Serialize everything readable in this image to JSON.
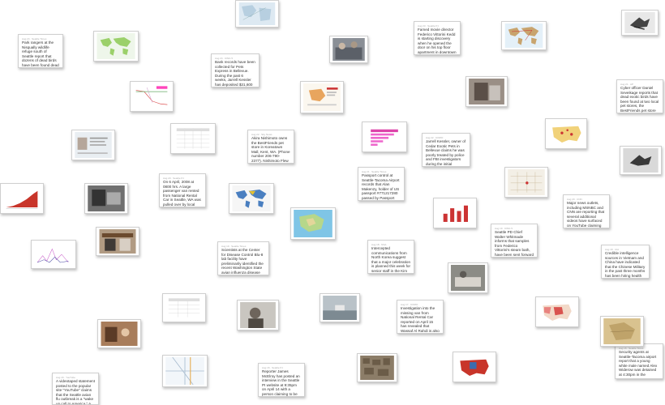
{
  "colors": {
    "map_green": "#9bd06a",
    "map_sea": "#cfe6f5",
    "heat_red": "#c8352a",
    "photo_gray": "#7a7a7a"
  },
  "notes": [
    {
      "meta": "Aug 24 · Seattle Times",
      "text": "Park rangers at the Nisqually wildlife refuge south of Seattle report that dozens of dead birds have been found dead in the past 24 hours in and"
    },
    {
      "meta": "Aug 24 · KING 5",
      "text": "Bank records have been collected for Pets Express in Bellevue. During the past 6 weeks, Jarrell Kessler has deposited $31,600 in"
    },
    {
      "meta": "Aug 23 · Seattle P-I",
      "text": "Famed movie director Federico Vittorini Kedd is starting discovery when he opened the door on his top floor apartment in downtown"
    },
    {
      "meta": "Aug 22 · Sky News",
      "text": "Akira Nishimoto owns the BestFriends pet store in Koreatown Mall, Kent, WA. (Phone number 206-790-2377). Nishimoto Flew Back two"
    },
    {
      "meta": "Aug 22 · KOMO",
      "text": "Jarrell Kessler, owner of Cedar Exotic Pets in Bellevue claims he was poorly treated by police and FBI investigators during the initial"
    },
    {
      "meta": "Aug 21 · Seattle Times",
      "text": "Passport control at Seattle-Tacoma Airport records that Alan Makenzy, holder of US passport #771217280 passed by Passport"
    },
    {
      "meta": "Aug 21 · AP",
      "text": "Cyber officer Daniel Seveikage reports that dead exotic birds have been found at two local pet stores, the BestFriends pet store in"
    },
    {
      "meta": "Aug 20 · Seattle P-I",
      "text": "On 6 April, 2008 at 0800 hrs. A large passenger van rented from National Rental Car in Seattle, WA was pulled over by local police for speeding"
    },
    {
      "meta": "Aug 20 · CNN",
      "text": "Major news outlets, including MSNBC and CNN are reporting that several additional videos have surfaced on YouTube claiming"
    },
    {
      "meta": "Aug 19 · KING 5",
      "text": "Seattle PD Chief Walter Whitmade informs that samples from Federico Vittorini's steam bath, have been sent forward to CDC laboratories in"
    },
    {
      "meta": "Aug 19 · Seattle Times",
      "text": "Scientists at the Center for Disease Control Blu-8 lab facility have preliminarily identified the recent Washington State avian influenza disease"
    },
    {
      "meta": "Aug 18 · NSA",
      "text": "Intercepted communications from North Korea suggest that a major celebration is planned this week for senior staff in the Kim"
    },
    {
      "meta": "Aug 18 · CIA",
      "text": "Credible intelligence sources in Vietnam and China have indicated that the Chinese Military in the past three months has been hiring health"
    },
    {
      "meta": "Aug 17 · KOMO",
      "text": "Investigation into the missing van from National Rental Car reported on April 15 has revealed that Wassaf Al Rahdi is also known as"
    },
    {
      "meta": "Aug 16 · YouTube",
      "text": "A videotaped statement posted to the popular site \"YouTube\" claims that the Seattle avian flu outbreak is a \"wake up call to America.\" A man named"
    },
    {
      "meta": "Aug 16 · Seattle P-I",
      "text": "Reporter James McElroy has posted an interview in the Seattle PI website at 9:35pm on April 14 with a person claiming to be under \"this_438\" who"
    },
    {
      "meta": "Aug 15 · Seattle Times",
      "text": "Security agents at Seattle-Tacoma airport report that a young white male named Alex Widerow was detained at 4:30pm in the"
    }
  ]
}
